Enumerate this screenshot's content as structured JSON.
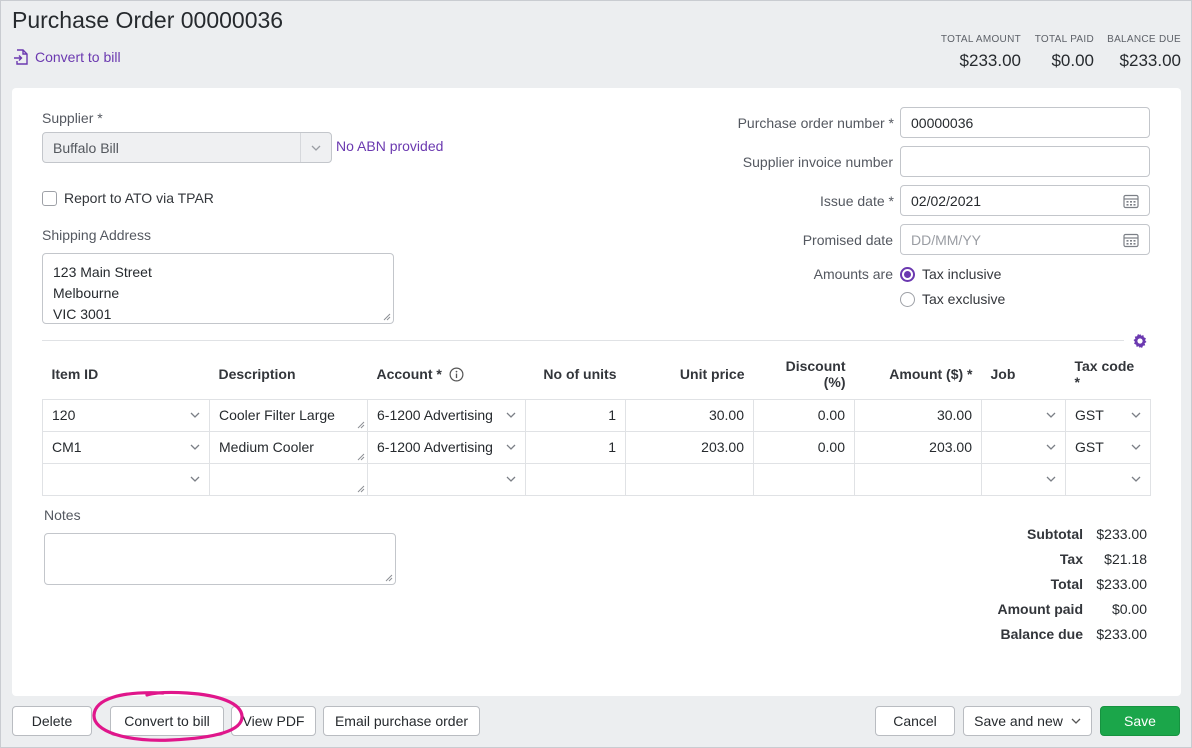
{
  "header": {
    "title": "Purchase Order 00000036",
    "convert_link": "Convert to bill"
  },
  "summary": [
    {
      "label": "TOTAL AMOUNT",
      "value": "$233.00"
    },
    {
      "label": "TOTAL PAID",
      "value": "$0.00"
    },
    {
      "label": "BALANCE DUE",
      "value": "$233.00"
    }
  ],
  "form": {
    "supplier_label": "Supplier",
    "supplier_value": "Buffalo Bill",
    "abn_text": "No ABN provided",
    "report_tpar": "Report to ATO via TPAR",
    "shipping_label": "Shipping Address",
    "shipping_lines": [
      "123 Main Street",
      "Melbourne",
      "VIC 3001"
    ],
    "po_number_label": "Purchase order number",
    "po_number_value": "00000036",
    "supplier_invoice_label": "Supplier invoice number",
    "supplier_invoice_value": "",
    "issue_date_label": "Issue date",
    "issue_date_value": "02/02/2021",
    "promised_date_label": "Promised date",
    "promised_date_placeholder": "DD/MM/YY",
    "amounts_are_label": "Amounts are",
    "tax_inclusive": "Tax inclusive",
    "tax_exclusive": "Tax exclusive",
    "required_mark": "*"
  },
  "table": {
    "headers": {
      "item_id": "Item ID",
      "description": "Description",
      "account": "Account *",
      "units": "No of units",
      "unit_price": "Unit price",
      "discount": "Discount (%)",
      "amount": "Amount ($) *",
      "job": "Job",
      "tax_code": "Tax code *"
    },
    "rows": [
      {
        "item_id": "120",
        "description": "Cooler Filter Large",
        "account": "6-1200 Advertising",
        "units": "1",
        "unit_price": "30.00",
        "discount": "0.00",
        "amount": "30.00",
        "job": "",
        "tax_code": "GST"
      },
      {
        "item_id": "CM1",
        "description": "Medium Cooler",
        "account": "6-1200 Advertising",
        "units": "1",
        "unit_price": "203.00",
        "discount": "0.00",
        "amount": "203.00",
        "job": "",
        "tax_code": "GST"
      },
      {
        "item_id": "",
        "description": "",
        "account": "",
        "units": "",
        "unit_price": "",
        "discount": "",
        "amount": "",
        "job": "",
        "tax_code": ""
      }
    ]
  },
  "notes": {
    "label": "Notes",
    "value": ""
  },
  "totals": [
    {
      "label": "Subtotal",
      "value": "$233.00"
    },
    {
      "label": "Tax",
      "value": "$21.18"
    },
    {
      "label": "Total",
      "value": "$233.00"
    },
    {
      "label": "Amount paid",
      "value": "$0.00"
    },
    {
      "label": "Balance due",
      "value": "$233.00"
    }
  ],
  "footer": {
    "delete": "Delete",
    "convert_to_bill": "Convert to bill",
    "view_pdf": "View PDF",
    "email_po": "Email purchase order",
    "cancel": "Cancel",
    "save_and_new": "Save and new",
    "save": "Save"
  },
  "colors": {
    "accent": "#6b39b0",
    "primary": "#1ba64a",
    "highlight": "#e0168b"
  }
}
